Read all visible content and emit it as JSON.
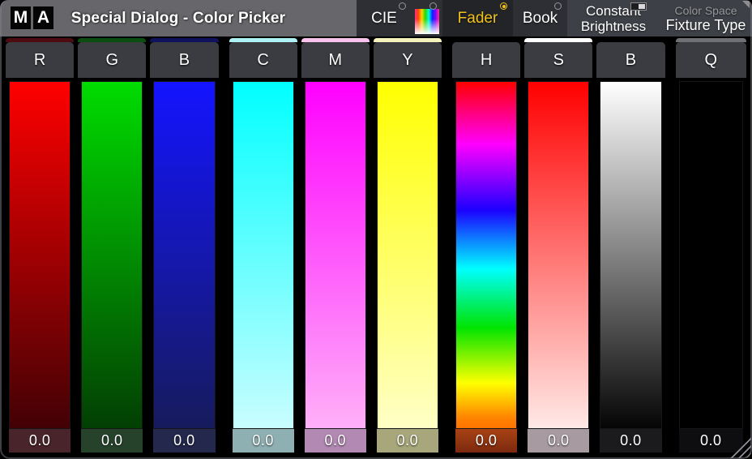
{
  "titlebar": {
    "logo": {
      "m": "M",
      "a": "A"
    },
    "title": "Special Dialog -  Color Picker"
  },
  "tabs": [
    {
      "label": "CIE",
      "active": false
    },
    {
      "label": "",
      "icon": "color-gradient-swatch",
      "active": false
    },
    {
      "label": "Fader",
      "active": true
    },
    {
      "label": "Book",
      "active": false
    }
  ],
  "controls": {
    "constant_brightness": {
      "label_line1": "Constant",
      "label_line2": "Brightness",
      "toggle_on": true
    },
    "fixture_type": {
      "caption": "Color Space",
      "label": "Fixture Type"
    }
  },
  "colors": {
    "accent": "#f2c21c",
    "titlebar_bg": "#67676b",
    "tabbar_bg": "#2d2f34",
    "active_tab_bg": "#222428",
    "rightbar_bg": "#3d4046",
    "header_bg": "#3a3c42"
  },
  "faders": [
    {
      "label": "R",
      "value": "0.0",
      "group": 0,
      "strip": "#4e0b10",
      "gradient_stops": [
        [
          "#ff0000",
          0
        ],
        [
          "#420105",
          100
        ]
      ],
      "box": [
        "#49252b"
      ]
    },
    {
      "label": "G",
      "value": "0.0",
      "group": 0,
      "strip": "#0b4e10",
      "gradient_stops": [
        [
          "#00dc00",
          0
        ],
        [
          "#023f03",
          100
        ]
      ],
      "box": [
        "#26422b"
      ]
    },
    {
      "label": "B",
      "value": "0.0",
      "group": 0,
      "strip": "#11125e",
      "gradient_stops": [
        [
          "#1414ff",
          0
        ],
        [
          "#161b5c",
          100
        ]
      ],
      "box": [
        "#23284c"
      ]
    },
    {
      "label": "C",
      "value": "0.0",
      "group": 1,
      "strip": "#aef2f6",
      "gradient_stops": [
        [
          "#00ffff",
          0
        ],
        [
          "#c9fdff",
          100
        ]
      ],
      "box": [
        "#8fb0b2"
      ]
    },
    {
      "label": "M",
      "value": "0.0",
      "group": 1,
      "strip": "#f8c2ec",
      "gradient_stops": [
        [
          "#ff00ff",
          0
        ],
        [
          "#ffb0f8",
          100
        ]
      ],
      "box": [
        "#b289b3"
      ]
    },
    {
      "label": "Y",
      "value": "0.0",
      "group": 1,
      "strip": "#f6f2bc",
      "gradient_stops": [
        [
          "#ffff00",
          0
        ],
        [
          "#ffffc6",
          100
        ]
      ],
      "box": [
        "#a7a77b"
      ]
    },
    {
      "label": "H",
      "value": "0.0",
      "group": 2,
      "strip": null,
      "gradient_stops": [
        [
          "#ff0000",
          0
        ],
        [
          "#ff00ff",
          18
        ],
        [
          "#1c00ff",
          37
        ],
        [
          "#00ffff",
          54
        ],
        [
          "#00e400",
          71
        ],
        [
          "#ffff00",
          87
        ],
        [
          "#ff8400",
          97
        ],
        [
          "#ff7300",
          100
        ]
      ],
      "box": [
        "#a84212",
        "#7c2910"
      ]
    },
    {
      "label": "S",
      "value": "0.0",
      "group": 2,
      "strip": "#ffffff",
      "gradient_stops": [
        [
          "#ff0000",
          0
        ],
        [
          "#ffe9e6",
          100
        ]
      ],
      "box": [
        "#a79aa1"
      ]
    },
    {
      "label": "B",
      "value": "0.0",
      "group": 2,
      "strip": null,
      "gradient_stops": [
        [
          "#ffffff",
          0
        ],
        [
          "#050505",
          100
        ]
      ],
      "box": [
        "#1b1b1d"
      ]
    },
    {
      "label": "Q",
      "value": "0.0",
      "group": 3,
      "strip": "#6e7074",
      "gradient_stops": [
        [
          "#000000",
          0
        ],
        [
          "#000000",
          100
        ]
      ],
      "box": [
        "#0e0e10"
      ]
    }
  ]
}
